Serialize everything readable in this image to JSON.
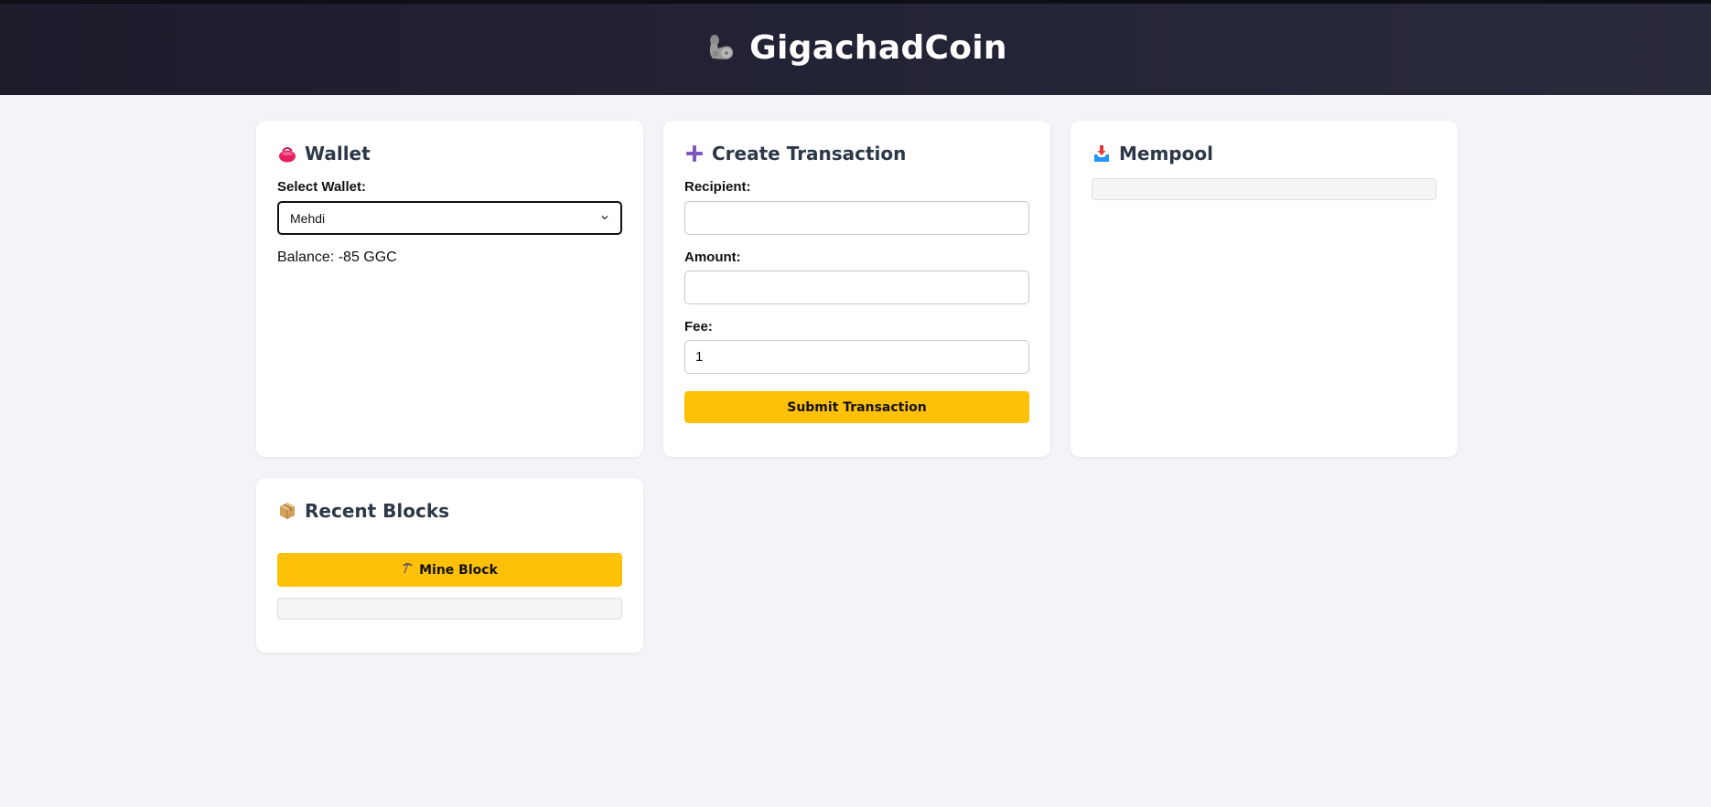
{
  "header": {
    "logo_icon": "flexed-bicep-icon",
    "title": "GigachadCoin"
  },
  "wallet": {
    "icon": "purse-icon",
    "title": "Wallet",
    "select_label": "Select Wallet:",
    "selected_wallet": "Mehdi",
    "balance": "Balance: -85 GGC"
  },
  "transaction": {
    "icon": "plus-icon",
    "title": "Create Transaction",
    "recipient_label": "Recipient:",
    "recipient_value": "",
    "amount_label": "Amount:",
    "amount_value": "",
    "fee_label": "Fee:",
    "fee_value": "1",
    "submit_label": "Submit Transaction"
  },
  "mempool": {
    "icon": "inbox-tray-icon",
    "title": "Mempool"
  },
  "blocks": {
    "icon": "package-icon",
    "title": "Recent Blocks",
    "mine_icon": "pick-icon",
    "mine_label": "Mine Block"
  },
  "colors": {
    "accent": "#ffc107",
    "header_bg": "#1c1c2b",
    "page_bg": "#f3f4f8",
    "card_title": "#2c3848"
  }
}
